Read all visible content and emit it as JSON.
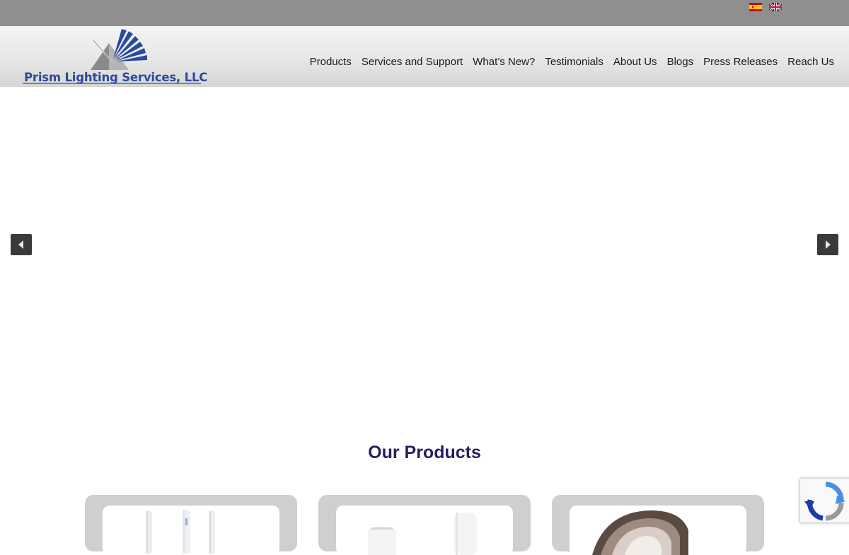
{
  "brand": {
    "name": "Prism Lighting Services, LLC",
    "color": "#2a4a9c"
  },
  "languages": [
    {
      "code": "es",
      "icon": "spain-flag-icon"
    },
    {
      "code": "en",
      "icon": "uk-flag-icon"
    }
  ],
  "nav": {
    "items": [
      {
        "label": "Products"
      },
      {
        "label": "Services and Support"
      },
      {
        "label": "What’s New?"
      },
      {
        "label": "Testimonials"
      },
      {
        "label": "About Us"
      },
      {
        "label": "Blogs"
      },
      {
        "label": "Press Releases"
      },
      {
        "label": "Reach Us"
      }
    ]
  },
  "slider": {
    "prev_icon": "chevron-left-icon",
    "next_icon": "chevron-right-icon"
  },
  "products_section": {
    "title": "Our Products",
    "title_color": "#241e62"
  },
  "widgets": {
    "recaptcha_icon": "recaptcha-icon"
  }
}
